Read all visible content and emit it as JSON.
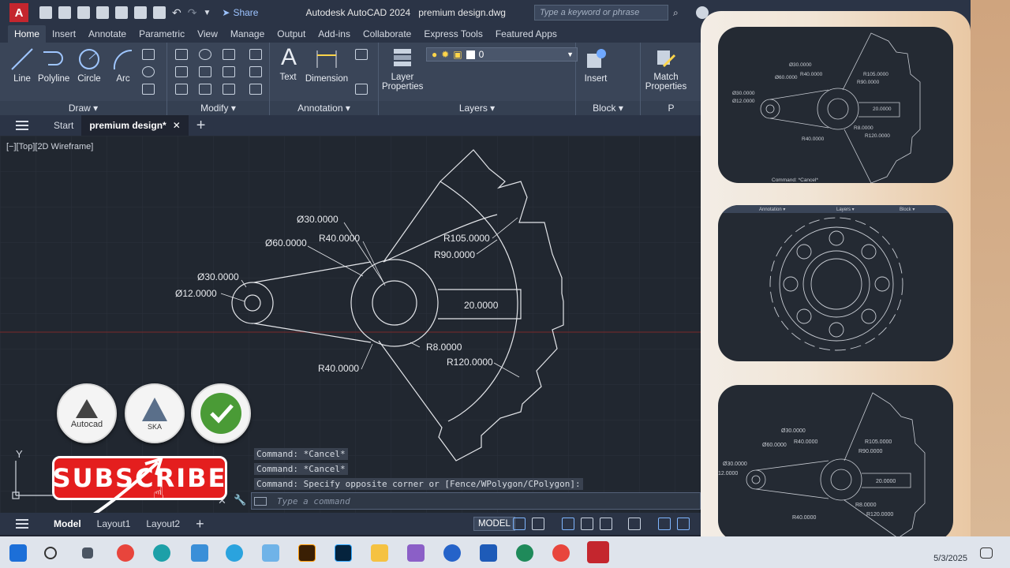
{
  "window": {
    "app_title": "Autodesk AutoCAD 2024",
    "file_title": "premium design.dwg",
    "share_label": "Share",
    "search_placeholder": "Type a keyword or phrase",
    "logo": "A"
  },
  "ribbon_tabs": [
    "Home",
    "Insert",
    "Annotate",
    "Parametric",
    "View",
    "Manage",
    "Output",
    "Add-ins",
    "Collaborate",
    "Express Tools",
    "Featured Apps"
  ],
  "ribbon": {
    "draw": {
      "line": "Line",
      "polyline": "Polyline",
      "circle": "Circle",
      "arc": "Arc",
      "footer": "Draw ▾"
    },
    "modify": {
      "footer": "Modify ▾"
    },
    "annotation": {
      "text": "Text",
      "dimension": "Dimension",
      "footer": "Annotation ▾"
    },
    "layers": {
      "layer_properties_1": "Layer",
      "layer_properties_2": "Properties",
      "current_layer": "0",
      "footer": "Layers ▾"
    },
    "block": {
      "insert": "Insert",
      "footer": "Block ▾"
    },
    "properties": {
      "match_1": "Match",
      "match_2": "Properties",
      "footer": "P"
    }
  },
  "file_tabs": {
    "start": "Start",
    "active": "premium design*"
  },
  "viewport_label": "[−][Top][2D Wireframe]",
  "dimensions": {
    "d30_top": "Ø30.0000",
    "r40_top": "R40.0000",
    "d60": "Ø60.0000",
    "d30_left": "Ø30.0000",
    "d12": "Ø12.0000",
    "r105": "R105.0000",
    "r90": "R90.0000",
    "w20": "20.0000",
    "r8": "R8.0000",
    "r120": "R120.0000",
    "r40_bottom": "R40.0000"
  },
  "ucs": {
    "y": "Y"
  },
  "command_history": [
    "Command: *Cancel*",
    "Command: *Cancel*",
    "Command: Specify opposite corner or [Fence/WPolygon/CPolygon]:"
  ],
  "command_placeholder": "Type a command",
  "status": {
    "model_tab": "Model",
    "layout1": "Layout1",
    "layout2": "Layout2",
    "model_button": "MODEL"
  },
  "logos": {
    "autocad": "Autocad",
    "ska": "SKA",
    "subscribe": "SUBSCRIBE"
  },
  "thumbnails": {
    "t1": {
      "d30": "Ø30.0000",
      "r40": "R40.0000",
      "d60": "Ø60.0000",
      "d30b": "Ø30.0000",
      "d12": "Ø12.0000",
      "r105": "R105.0000",
      "r90": "R90.0000",
      "w20": "20.0000",
      "r8": "R8.0000",
      "r120": "R120.0000",
      "r40b": "R40.0000",
      "cmd": "Command: *Cancel*"
    },
    "t2": {
      "annotation": "Annotation ▾",
      "layers": "Layers ▾",
      "block": "Block ▾"
    },
    "t3": {
      "d30": "Ø30.0000",
      "r40": "R40.0000",
      "d60": "Ø60.0000",
      "d30b": "Ø30.0000",
      "d12": "12.0000",
      "r105": "R105.0000",
      "r90": "R90.0000",
      "w20": "20.0000",
      "r8": "R8.0000",
      "r120": "R120.0000",
      "r40b": "R40.0000"
    }
  },
  "taskbar": {
    "date": "5/3/2025"
  },
  "colors": {
    "canvas": "#212730",
    "ribbon": "#3a4558",
    "subscribe": "#e41e1e",
    "autocad_red": "#c4262e"
  }
}
